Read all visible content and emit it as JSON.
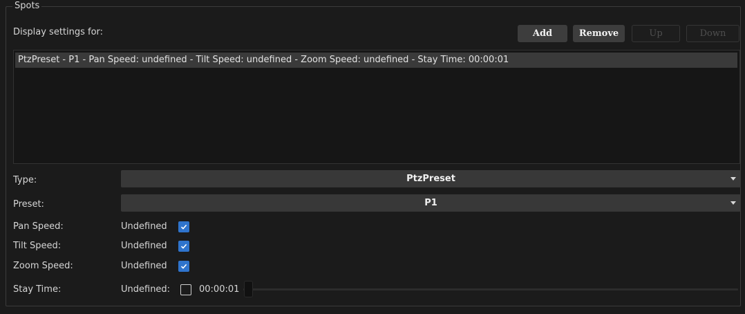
{
  "group": {
    "title": "Spots"
  },
  "display_settings_label": "Display settings for:",
  "buttons": {
    "add": "Add",
    "remove": "Remove",
    "up": "Up",
    "down": "Down"
  },
  "spots_list": [
    "PtzPreset - P1 - Pan Speed: undefined - Tilt Speed: undefined - Zoom Speed: undefined - Stay Time: 00:00:01"
  ],
  "fields": {
    "type": {
      "label": "Type:",
      "value": "PtzPreset"
    },
    "preset": {
      "label": "Preset:",
      "value": "P1"
    },
    "pan_speed": {
      "label": "Pan Speed:",
      "undefined_label": "Undefined",
      "undefined_checked": true
    },
    "tilt_speed": {
      "label": "Tilt Speed:",
      "undefined_label": "Undefined",
      "undefined_checked": true
    },
    "zoom_speed": {
      "label": "Zoom Speed:",
      "undefined_label": "Undefined",
      "undefined_checked": true
    },
    "stay_time": {
      "label": "Stay Time:",
      "undefined_label": "Undefined:",
      "undefined_checked": false,
      "value": "00:00:01"
    }
  },
  "colors": {
    "background": "#1b1b1b",
    "accent_checkbox": "#2f74cc",
    "button_enabled": "#3d3d3d",
    "selected_row": "#3a3a3a"
  }
}
